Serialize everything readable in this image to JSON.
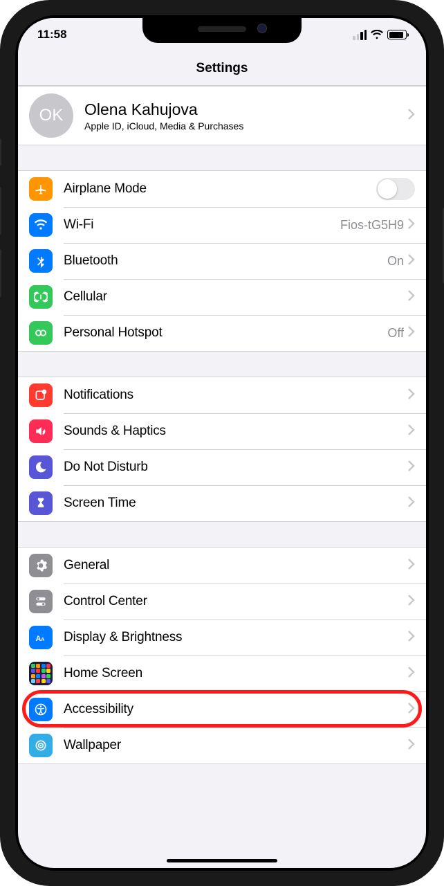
{
  "statusbar": {
    "time": "11:58"
  },
  "navbar": {
    "title": "Settings"
  },
  "profile": {
    "initials": "OK",
    "name": "Olena Kahujova",
    "subtitle": "Apple ID, iCloud, Media & Purchases"
  },
  "g1": {
    "airplane": "Airplane Mode",
    "wifi": "Wi-Fi",
    "wifi_val": "Fios-tG5H9",
    "bluetooth": "Bluetooth",
    "bluetooth_val": "On",
    "cellular": "Cellular",
    "hotspot": "Personal Hotspot",
    "hotspot_val": "Off"
  },
  "g2": {
    "notifications": "Notifications",
    "sounds": "Sounds & Haptics",
    "dnd": "Do Not Disturb",
    "screentime": "Screen Time"
  },
  "g3": {
    "general": "General",
    "control": "Control Center",
    "display": "Display & Brightness",
    "home": "Home Screen",
    "accessibility": "Accessibility",
    "wallpaper": "Wallpaper"
  },
  "highlighted_row": "accessibility"
}
